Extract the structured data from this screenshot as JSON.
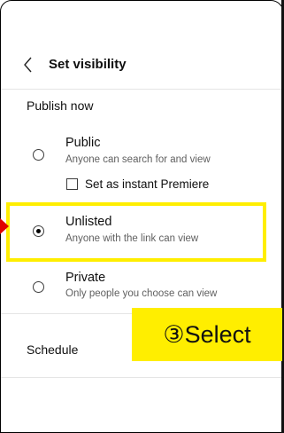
{
  "header": {
    "title": "Set visibility",
    "back_icon": "chevron-left-icon"
  },
  "publish_now": {
    "label": "Publish now",
    "options": [
      {
        "label": "Public",
        "sublabel": "Anyone can search for and view",
        "selected": false
      },
      {
        "label": "Unlisted",
        "sublabel": "Anyone with the link can view",
        "selected": true
      },
      {
        "label": "Private",
        "sublabel": "Only people you choose can view",
        "selected": false
      }
    ],
    "premiere_checkbox": {
      "label": "Set as instant Premiere",
      "checked": false
    }
  },
  "schedule": {
    "label": "Schedule"
  },
  "annotation": {
    "text": "③Select",
    "highlight_color": "#ffee00",
    "arrow_color": "#e00000"
  }
}
